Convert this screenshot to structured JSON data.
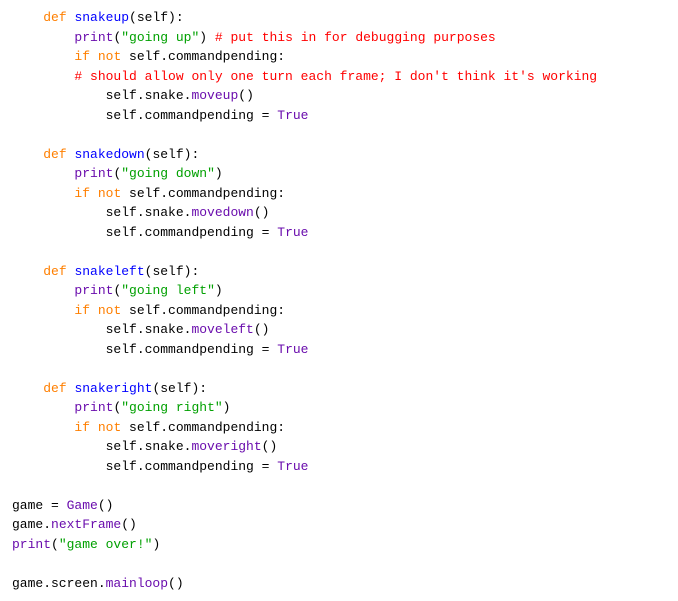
{
  "code": {
    "l1": {
      "kw": "def",
      "name": "snakeup",
      "args": "(self):"
    },
    "l2": {
      "call": "print",
      "par": "(",
      "str": "\"going up\"",
      "close": ")",
      "spc": " ",
      "cmt": "# put this in for debugging purposes"
    },
    "l3": {
      "kw1": "if",
      "kw2": "not",
      "rest": " self.commandpending:"
    },
    "l4": {
      "cmt": "# should allow only one turn each frame; I don't think it's working"
    },
    "l5": {
      "pre": "self.snake.",
      "call": "moveup",
      "post": "()"
    },
    "l6": {
      "lhs": "self.commandpending = ",
      "bool": "True"
    },
    "l7": {
      "kw": "def",
      "name": "snakedown",
      "args": "(self):"
    },
    "l8": {
      "call": "print",
      "par": "(",
      "str": "\"going down\"",
      "close": ")"
    },
    "l9": {
      "kw1": "if",
      "kw2": "not",
      "rest": " self.commandpending:"
    },
    "l10": {
      "pre": "self.snake.",
      "call": "movedown",
      "post": "()"
    },
    "l11": {
      "lhs": "self.commandpending = ",
      "bool": "True"
    },
    "l12": {
      "kw": "def",
      "name": "snakeleft",
      "args": "(self):"
    },
    "l13": {
      "call": "print",
      "par": "(",
      "str": "\"going left\"",
      "close": ")"
    },
    "l14": {
      "kw1": "if",
      "kw2": "not",
      "rest": " self.commandpending:"
    },
    "l15": {
      "pre": "self.snake.",
      "call": "moveleft",
      "post": "()"
    },
    "l16": {
      "lhs": "self.commandpending = ",
      "bool": "True"
    },
    "l17": {
      "kw": "def",
      "name": "snakeright",
      "args": "(self):"
    },
    "l18": {
      "call": "print",
      "par": "(",
      "str": "\"going right\"",
      "close": ")"
    },
    "l19": {
      "kw1": "if",
      "kw2": "not",
      "rest": " self.commandpending:"
    },
    "l20": {
      "pre": "self.snake.",
      "call": "moveright",
      "post": "()"
    },
    "l21": {
      "lhs": "self.commandpending = ",
      "bool": "True"
    },
    "b1": "game = ",
    "b1call": "Game",
    "b1post": "()",
    "b2": "game.",
    "b2call": "nextFrame",
    "b2post": "()",
    "b3call": "print",
    "b3par": "(",
    "b3str": "\"game over!\"",
    "b3close": ")",
    "b4": "game.screen.",
    "b4call": "mainloop",
    "b4post": "()"
  },
  "ind": {
    "i1": "    ",
    "i2": "        ",
    "i3": "            "
  }
}
